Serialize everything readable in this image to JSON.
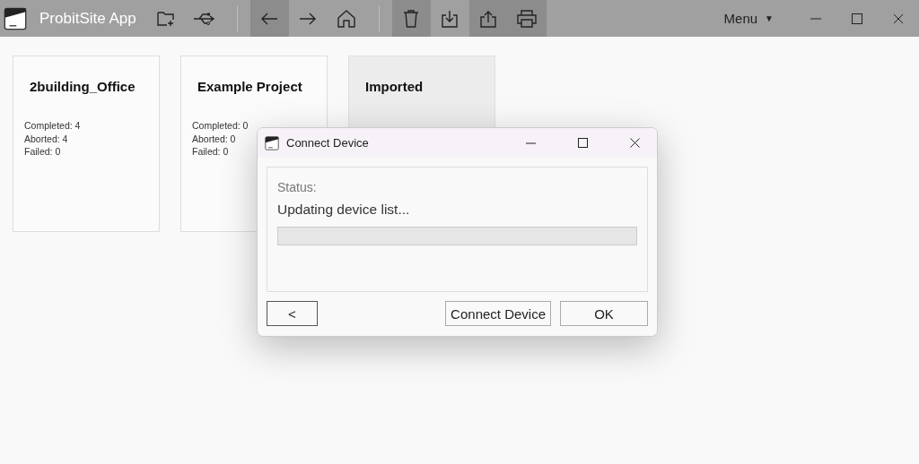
{
  "app": {
    "title": "ProbitSite App"
  },
  "toolbar": [
    {
      "kind": "new-folder",
      "highlighted": false
    },
    {
      "kind": "usb",
      "highlighted": false
    },
    {
      "kind": "back",
      "highlighted": true
    },
    {
      "kind": "forward",
      "highlighted": false
    },
    {
      "kind": "home",
      "highlighted": false
    },
    {
      "kind": "delete",
      "highlighted": true
    },
    {
      "kind": "download",
      "highlighted": false
    },
    {
      "kind": "upload",
      "highlighted": true
    },
    {
      "kind": "print",
      "highlighted": true
    }
  ],
  "menu": {
    "label": "Menu",
    "caret": "▼"
  },
  "projects": [
    {
      "name": "2building_Office",
      "selected": false,
      "stats": [
        "Completed: 4",
        "Aborted: 4",
        "Failed: 0"
      ]
    },
    {
      "name": "Example Project",
      "selected": false,
      "stats": [
        "Completed: 0",
        "Aborted: 0",
        "Failed: 0"
      ]
    },
    {
      "name": "Imported",
      "selected": true
    }
  ],
  "dialog": {
    "title": "Connect Device",
    "status_label": "Status:",
    "status": "Updating device list...",
    "progress": {
      "level": 0
    },
    "buttons": [
      {
        "label": "<"
      },
      {
        "label": "Connect Device"
      },
      {
        "label": "OK"
      }
    ]
  }
}
